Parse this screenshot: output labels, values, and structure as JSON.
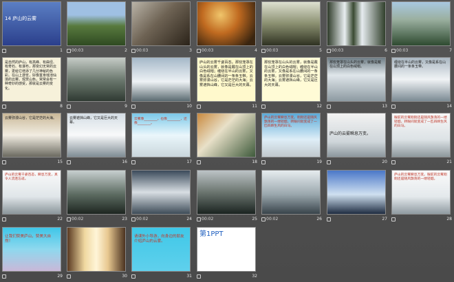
{
  "slides": [
    {
      "n": "1",
      "timer": "",
      "text": "14 庐山的云雾",
      "kind": "title"
    },
    {
      "n": "2",
      "timer": "00:03",
      "text": "",
      "kind": "photo1"
    },
    {
      "n": "3",
      "timer": "00:03",
      "text": "",
      "kind": "photo2"
    },
    {
      "n": "4",
      "timer": "00:03",
      "text": "",
      "kind": "photo3"
    },
    {
      "n": "5",
      "timer": "00:03",
      "text": "",
      "kind": "photo4"
    },
    {
      "n": "6",
      "timer": "00:03",
      "text": "",
      "kind": "falls"
    },
    {
      "n": "7",
      "timer": "00:03",
      "text": "",
      "kind": "falls2"
    },
    {
      "n": "8",
      "timer": "",
      "text": "是自然的庐山，有高峰、有曲径、有奇石、有瀑布，那变幻无常的云雾，更给它增添了几分神秘的色彩。在山上游览，好像置身瑶池仙境的云雾。观赏山色，常常会有一种奇妙的感受，那就是云雾的变化。",
      "kind": "text-cream"
    },
    {
      "n": "9",
      "timer": "",
      "text": "",
      "kind": "peaks"
    },
    {
      "n": "10",
      "timer": "",
      "text": "",
      "kind": "seaclouds"
    },
    {
      "n": "11",
      "timer": "",
      "text": "庐山的云雾千姿百态。那些笼罩在山头的云雾，就像是戴在山顶上的白色绒帽；缠绕在半山的云雾，又像是系在山腰间的一条条玉带。云雾弥漫山谷，它是茫茫的大海；云雾遮挡山峰，它又是巨大的天幕。",
      "kind": "text-yellow"
    },
    {
      "n": "12",
      "timer": "",
      "text": "那些笼罩在山头的云雾，就像是戴在山顶上的白色绒帽；缠绕在半山的云雾，又像是系在山腰间的一条条玉带。云雾弥漫山谷，它是茫茫的大海；云雾遮挡山峰，它又是巨大的天幕。",
      "kind": "text-yellow2"
    },
    {
      "n": "13",
      "timer": "",
      "text": "那些笼罩在山头的云雾，就像是戴在山顶上的白色绒帽。",
      "kind": "photo-text"
    },
    {
      "n": "14",
      "timer": "",
      "text": "缠绕在半山的云雾，又像是系在山腰间的一条条玉带。",
      "kind": "photo-text2"
    },
    {
      "n": "15",
      "timer": "",
      "text": "云雾弥漫山谷，它是茫茫的大海。",
      "kind": "photo-text3"
    },
    {
      "n": "16",
      "timer": "",
      "text": "云雾遮挡山峰，它又是巨大的天幕。",
      "kind": "photo-text4"
    },
    {
      "n": "17",
      "timer": "",
      "text": "云雾像________，也像________，还像________。",
      "kind": "fill"
    },
    {
      "n": "18",
      "timer": "",
      "text": "",
      "kind": "collage"
    },
    {
      "n": "19",
      "timer": "",
      "text": "庐山的云雾瞬息万变。刚刚还是随风飘荡的一缕轻烟，转眼间就变成了一匹四蹄生风的白马。",
      "kind": "story"
    },
    {
      "n": "20",
      "timer": "",
      "text": "庐山的云雾瞬息万变。",
      "kind": "bigtitle"
    },
    {
      "n": "21",
      "timer": "",
      "text": "眼前的云雾刚刚还是随风飘荡的一缕轻烟，转眼间就变成了一匹四蹄生风的白马。",
      "kind": "story2"
    },
    {
      "n": "22",
      "timer": "",
      "text": "庐山的云雾千姿百态，瞬息万变，真令人流连忘返。",
      "kind": "story3"
    },
    {
      "n": "23",
      "timer": "00:02",
      "text": "",
      "kind": "dark1"
    },
    {
      "n": "24",
      "timer": "00:02",
      "text": "",
      "kind": "dark2"
    },
    {
      "n": "25",
      "timer": "00:02",
      "text": "",
      "kind": "dark3"
    },
    {
      "n": "26",
      "timer": "00:02",
      "text": "",
      "kind": "dark4"
    },
    {
      "n": "27",
      "timer": "",
      "text": "",
      "kind": "blue1"
    },
    {
      "n": "28",
      "timer": "",
      "text": "庐山的云雾瞬息万变。眼前的云雾刚刚还是随风飘荡的一缕轻烟。",
      "kind": "story4"
    },
    {
      "n": "29",
      "timer": "",
      "text": "让我们赞美庐山，赞美大自然！",
      "kind": "cyan-text"
    },
    {
      "n": "30",
      "timer": "",
      "text": "",
      "kind": "waterfall3"
    },
    {
      "n": "31",
      "timer": "",
      "text": "请课外小导游，向身边的朋友介绍庐山的云雾。",
      "kind": "cyan2"
    },
    {
      "n": "32",
      "timer": "",
      "text": "第1PPT",
      "kind": "brand"
    }
  ],
  "colors": {
    "bg": "#4b4b4b",
    "caption": "#e6e6e6"
  }
}
